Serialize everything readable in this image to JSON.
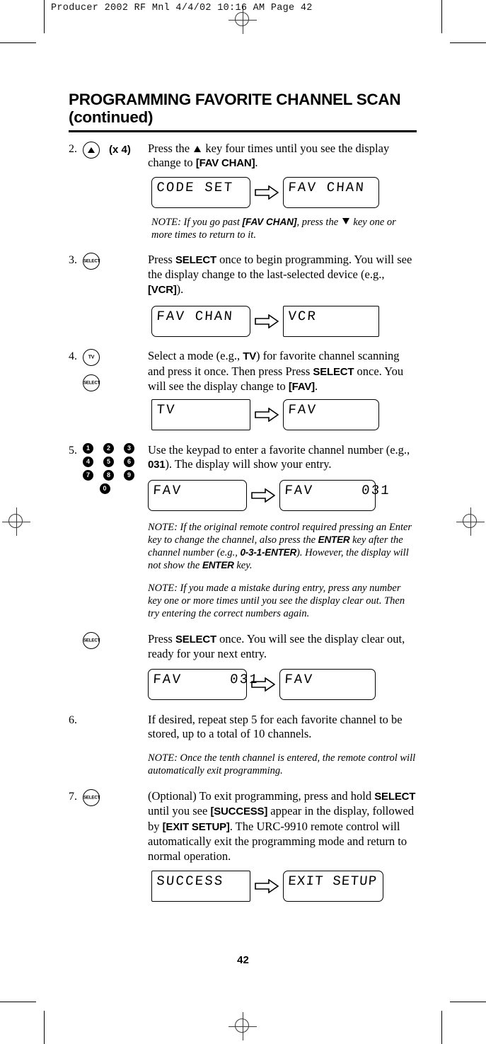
{
  "slug": "Producer 2002 RF Mnl  4/4/02  10:16 AM  Page 42",
  "title": {
    "line1": "PROGRAMMING FAVORITE CHANNEL SCAN",
    "line2": "(continued)"
  },
  "page_number": "42",
  "steps": [
    {
      "num": "2.",
      "icon": "up-arrow-button",
      "icon_label": "",
      "repeat_label": "(x 4)",
      "text_html": "Press the ▲ key four times until you see the display change to [FAV CHAN].",
      "text_parts": {
        "a": "Press the ",
        "b": " key four times until you see the display change to ",
        "bold": "[FAV CHAN]",
        "c": "."
      },
      "lcd_from": "CODE SET",
      "lcd_to": "FAV CHAN",
      "note": {
        "prefix": "NOTE: If you go past ",
        "bold1": "[FAV CHAN]",
        "mid": ", press the ",
        "suffix": " key one or more times to return to it."
      }
    },
    {
      "num": "3.",
      "icon": "select-button",
      "icon_label": "SELECT",
      "text_parts": {
        "a": "Press ",
        "bold": "SELECT",
        "b": " once to begin programming. You will see the display change to the last-selected device (e.g., ",
        "bold2": "[VCR]",
        "c": ")."
      },
      "lcd_from": "FAV CHAN",
      "lcd_to": "VCR"
    },
    {
      "num": "4.",
      "icon": "tv-button",
      "icon_label": "TV",
      "icon2": "select-button",
      "icon2_label": "SELECT",
      "text_parts": {
        "a": "Select a mode (e.g., ",
        "bold": "TV",
        "b": ") for favorite channel scanning and press it once. Then press Press ",
        "bold2": "SELECT",
        "c": " once. You will see the display change to  ",
        "bold3": "[FAV]",
        "d": "."
      },
      "lcd_from": "TV",
      "lcd_to": "FAV"
    },
    {
      "num": "5.",
      "icon": "numeric-keypad",
      "keys": [
        "1",
        "2",
        "3",
        "4",
        "5",
        "6",
        "7",
        "8",
        "9",
        "0"
      ],
      "text_parts": {
        "a": "Use the keypad to enter a favorite channel number (e.g., ",
        "bold": "031",
        "b": "). The display will show your entry."
      },
      "lcd_from": "FAV",
      "lcd_to": "FAV     031",
      "note1": {
        "a": "NOTE: If the original remote control required pressing an Enter key to change the channel, also press the ",
        "bold1": "ENTER",
        "b": " key after the channel number (e.g., ",
        "bold2": "0-3-1-ENTER",
        "c": "). However, the display will not show the ",
        "bold3": "ENTER",
        "d": " key."
      },
      "note2": {
        "a": "NOTE: If you made a mistake during entry, press any number key one or more times until you see the display clear out. Then try entering the correct numbers again."
      }
    },
    {
      "num": "",
      "icon": "select-button",
      "icon_label": "SELECT",
      "text_parts": {
        "a": "Press ",
        "bold": "SELECT",
        "b": " once. You will see the display clear out, ready for your next entry."
      },
      "lcd_from": "FAV     031",
      "lcd_to": "FAV"
    },
    {
      "num": "6.",
      "icon": "",
      "text_parts": {
        "a": "If desired, repeat step 5 for each favorite channel to be stored, up to a total of 10 channels."
      },
      "note": {
        "a": "NOTE: Once the tenth channel is entered, the remote control will automatically exit programming."
      }
    },
    {
      "num": "7.",
      "icon": "select-button",
      "icon_label": "SELECT",
      "text_parts": {
        "a": "(Optional) To exit programming, press and hold ",
        "bold": "SELECT",
        "b": " until you see ",
        "bold2": "[SUCCESS]",
        "c": " appear in the display, followed by ",
        "bold3": "[EXIT SETUP]",
        "d": ". The URC-9910 remote control will automatically exit the programming mode and return to normal operation."
      },
      "lcd_from": "SUCCESS",
      "lcd_to": "EXIT SETUP"
    }
  ]
}
